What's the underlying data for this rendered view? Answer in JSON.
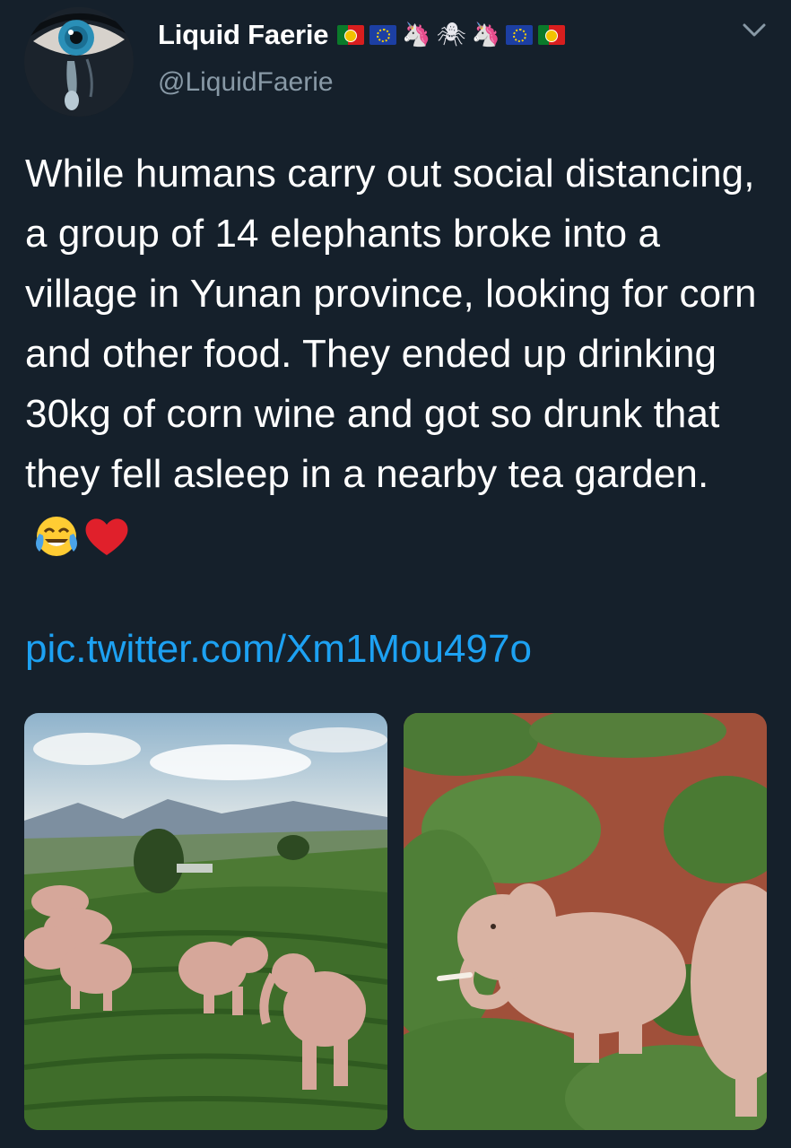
{
  "tweet": {
    "author": {
      "display_name": "Liquid Faerie",
      "handle": "@LiquidFaerie",
      "avatar_icon": "crying-eye-avatar",
      "name_emojis": [
        "portugal-flag",
        "eu-flag",
        "unicorn",
        "spider",
        "unicorn",
        "eu-flag",
        "portugal-flag"
      ]
    },
    "menu_icon": "chevron-down-icon",
    "text": "While humans carry out social distancing, a group of 14 elephants broke into a village in Yunan province, looking for corn and other food. They ended up drinking 30kg of corn wine and got so drunk that they fell asleep in a nearby tea garden.",
    "text_emojis": [
      "face-with-tears-of-joy",
      "red-heart"
    ],
    "link": "pic.twitter.com/Xm1Mou497o",
    "media": [
      {
        "subject": "elephant herd walking through a hillside tea plantation"
      },
      {
        "subject": "drunk elephants asleep among tea bushes, aerial view"
      }
    ]
  },
  "colors": {
    "background": "#15202b",
    "text": "#ffffff",
    "secondary_text": "#8899a6",
    "link": "#1da1f2"
  }
}
